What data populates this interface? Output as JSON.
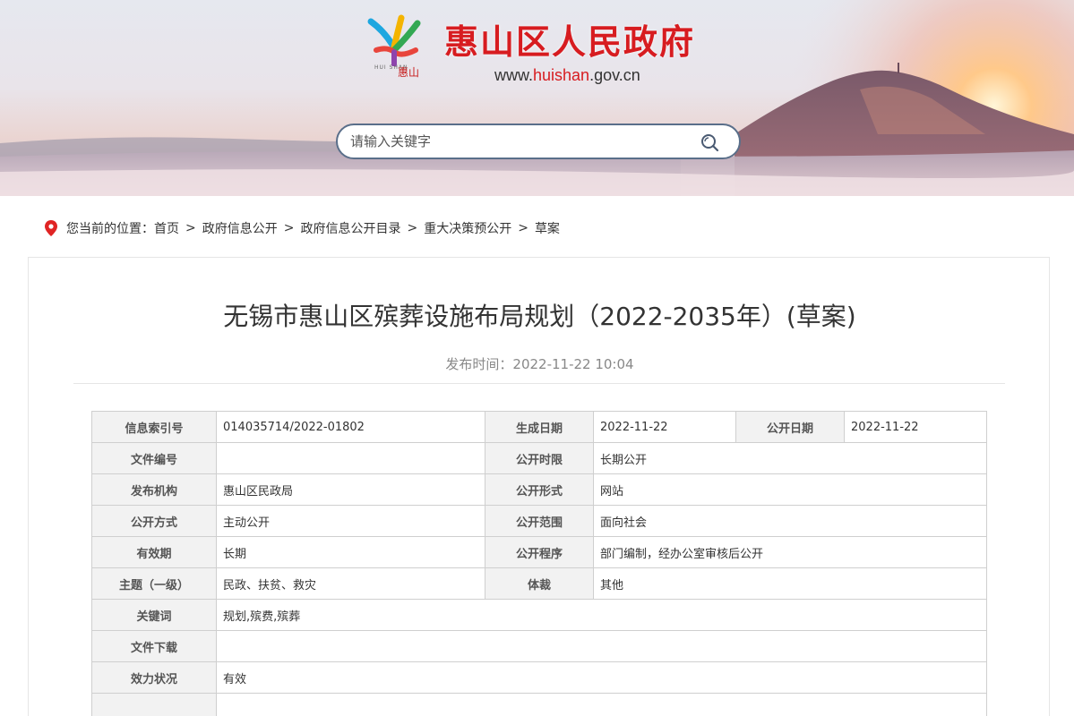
{
  "header": {
    "site_title": "惠山区人民政府",
    "url_prefix": "www.",
    "url_highlight": "huishan",
    "url_suffix": ".gov.cn",
    "logo_small_text": "HUI SHAN",
    "logo_small_cn": "惠山",
    "brand_color": "#d71c20"
  },
  "search": {
    "placeholder": "请输入关键字",
    "value": ""
  },
  "breadcrumb": {
    "prefix": "您当前的位置：",
    "items": [
      "首页",
      "政府信息公开",
      "政府信息公开目录",
      "重大决策预公开",
      "草案"
    ],
    "separator": ">"
  },
  "article": {
    "title": "无锡市惠山区殡葬设施布局规划（2022-2035年）(草案)",
    "publish_time": "发布时间：2022-11-22 10:04"
  },
  "meta_table": {
    "index_no_label": "信息索引号",
    "index_no": "014035714/2022-01802",
    "gen_date_label": "生成日期",
    "gen_date": "2022-11-22",
    "pub_date_label": "公开日期",
    "pub_date": "2022-11-22",
    "doc_no_label": "文件编号",
    "doc_no": "",
    "pub_period_label": "公开时限",
    "pub_period": "长期公开",
    "org_label": "发布机构",
    "org": "惠山区民政局",
    "pub_form_label": "公开形式",
    "pub_form": "网站",
    "pub_method_label": "公开方式",
    "pub_method": "主动公开",
    "pub_scope_label": "公开范围",
    "pub_scope": "面向社会",
    "validity_label": "有效期",
    "validity": "长期",
    "procedure_label": "公开程序",
    "procedure": "部门编制，经办公室审核后公开",
    "topic_label": "主题（一级）",
    "topic": "民政、扶贫、救灾",
    "genre_label": "体裁",
    "genre": "其他",
    "keywords_label": "关键词",
    "keywords": "规划,殡费,殡葬",
    "download_label": "文件下载",
    "download": "",
    "status_label": "效力状况",
    "status": "有效"
  }
}
